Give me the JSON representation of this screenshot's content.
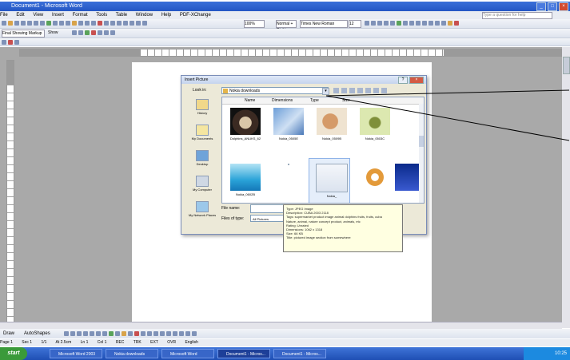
{
  "caption": "",
  "window": {
    "title": "Document1 - Microsoft Word",
    "menu": [
      "File",
      "Edit",
      "View",
      "Insert",
      "Format",
      "Tools",
      "Table",
      "Window",
      "Help",
      "PDF-XChange"
    ],
    "ask_placeholder": "Type a question for help"
  },
  "toolbars": {
    "style_value": "Final Showing Markup",
    "show_label": "Show",
    "zoom_value": "100%",
    "font_value": "Times New Roman",
    "font_size": "12",
    "style_box": "Normal + Right"
  },
  "dialog": {
    "title": "Insert Picture",
    "look_in_label": "Look in:",
    "look_in_value": "Nokia downloads",
    "columns": [
      "Name",
      "Dimensions",
      "Type",
      "Size"
    ],
    "places": [
      "History",
      "My Documents",
      "Desktop",
      "My Computer",
      "My Network Places"
    ],
    "files_row1": [
      "Dolphins_ANUKS_62",
      "Nokia_0505E",
      "Nokia_0509B",
      "Nokia_0503C"
    ],
    "files_row2": [
      "Nokia_0602B",
      "Nokia_",
      "",
      ""
    ],
    "file_name_label": "File name:",
    "files_of_type_label": "Files of type:",
    "files_of_type_value": "All Pictures"
  },
  "tooltip": {
    "lines": [
      "Type: JPEG Image",
      "Description: CUBA 2003 2118",
      "Tags: supermarket product image animal dolphins fruits, fruits, cuba",
      "Nature, animal, nature concept product, animals, etc",
      "Rating: Unrated",
      "Dimensions: 1062 x 1318",
      "Size: 66 KB",
      "Title: pictured image section from somewhere"
    ]
  },
  "drawing_bar": {
    "draw_label": "Draw",
    "autoshapes_label": "AutoShapes"
  },
  "status": {
    "page": "Page 1",
    "sec": "Sec 1",
    "pos": "1/1",
    "at": "At 2.5cm",
    "ln": "Ln 1",
    "col": "Col 1",
    "modes": [
      "REC",
      "TRK",
      "EXT",
      "OVR"
    ],
    "lang": "English"
  },
  "taskbar": {
    "start_label": "start",
    "tasks": [
      "Microsoft Word 2003",
      "Nokia downloads",
      "Microsoft Word",
      "Document1 - Micros...",
      "Document1 - Micros..."
    ],
    "time": "10:25"
  },
  "colors": {
    "caption_blue": "#1f4fff",
    "workspace_gray": "#a9a9a9",
    "taskbar_blue": "#2456c4"
  }
}
